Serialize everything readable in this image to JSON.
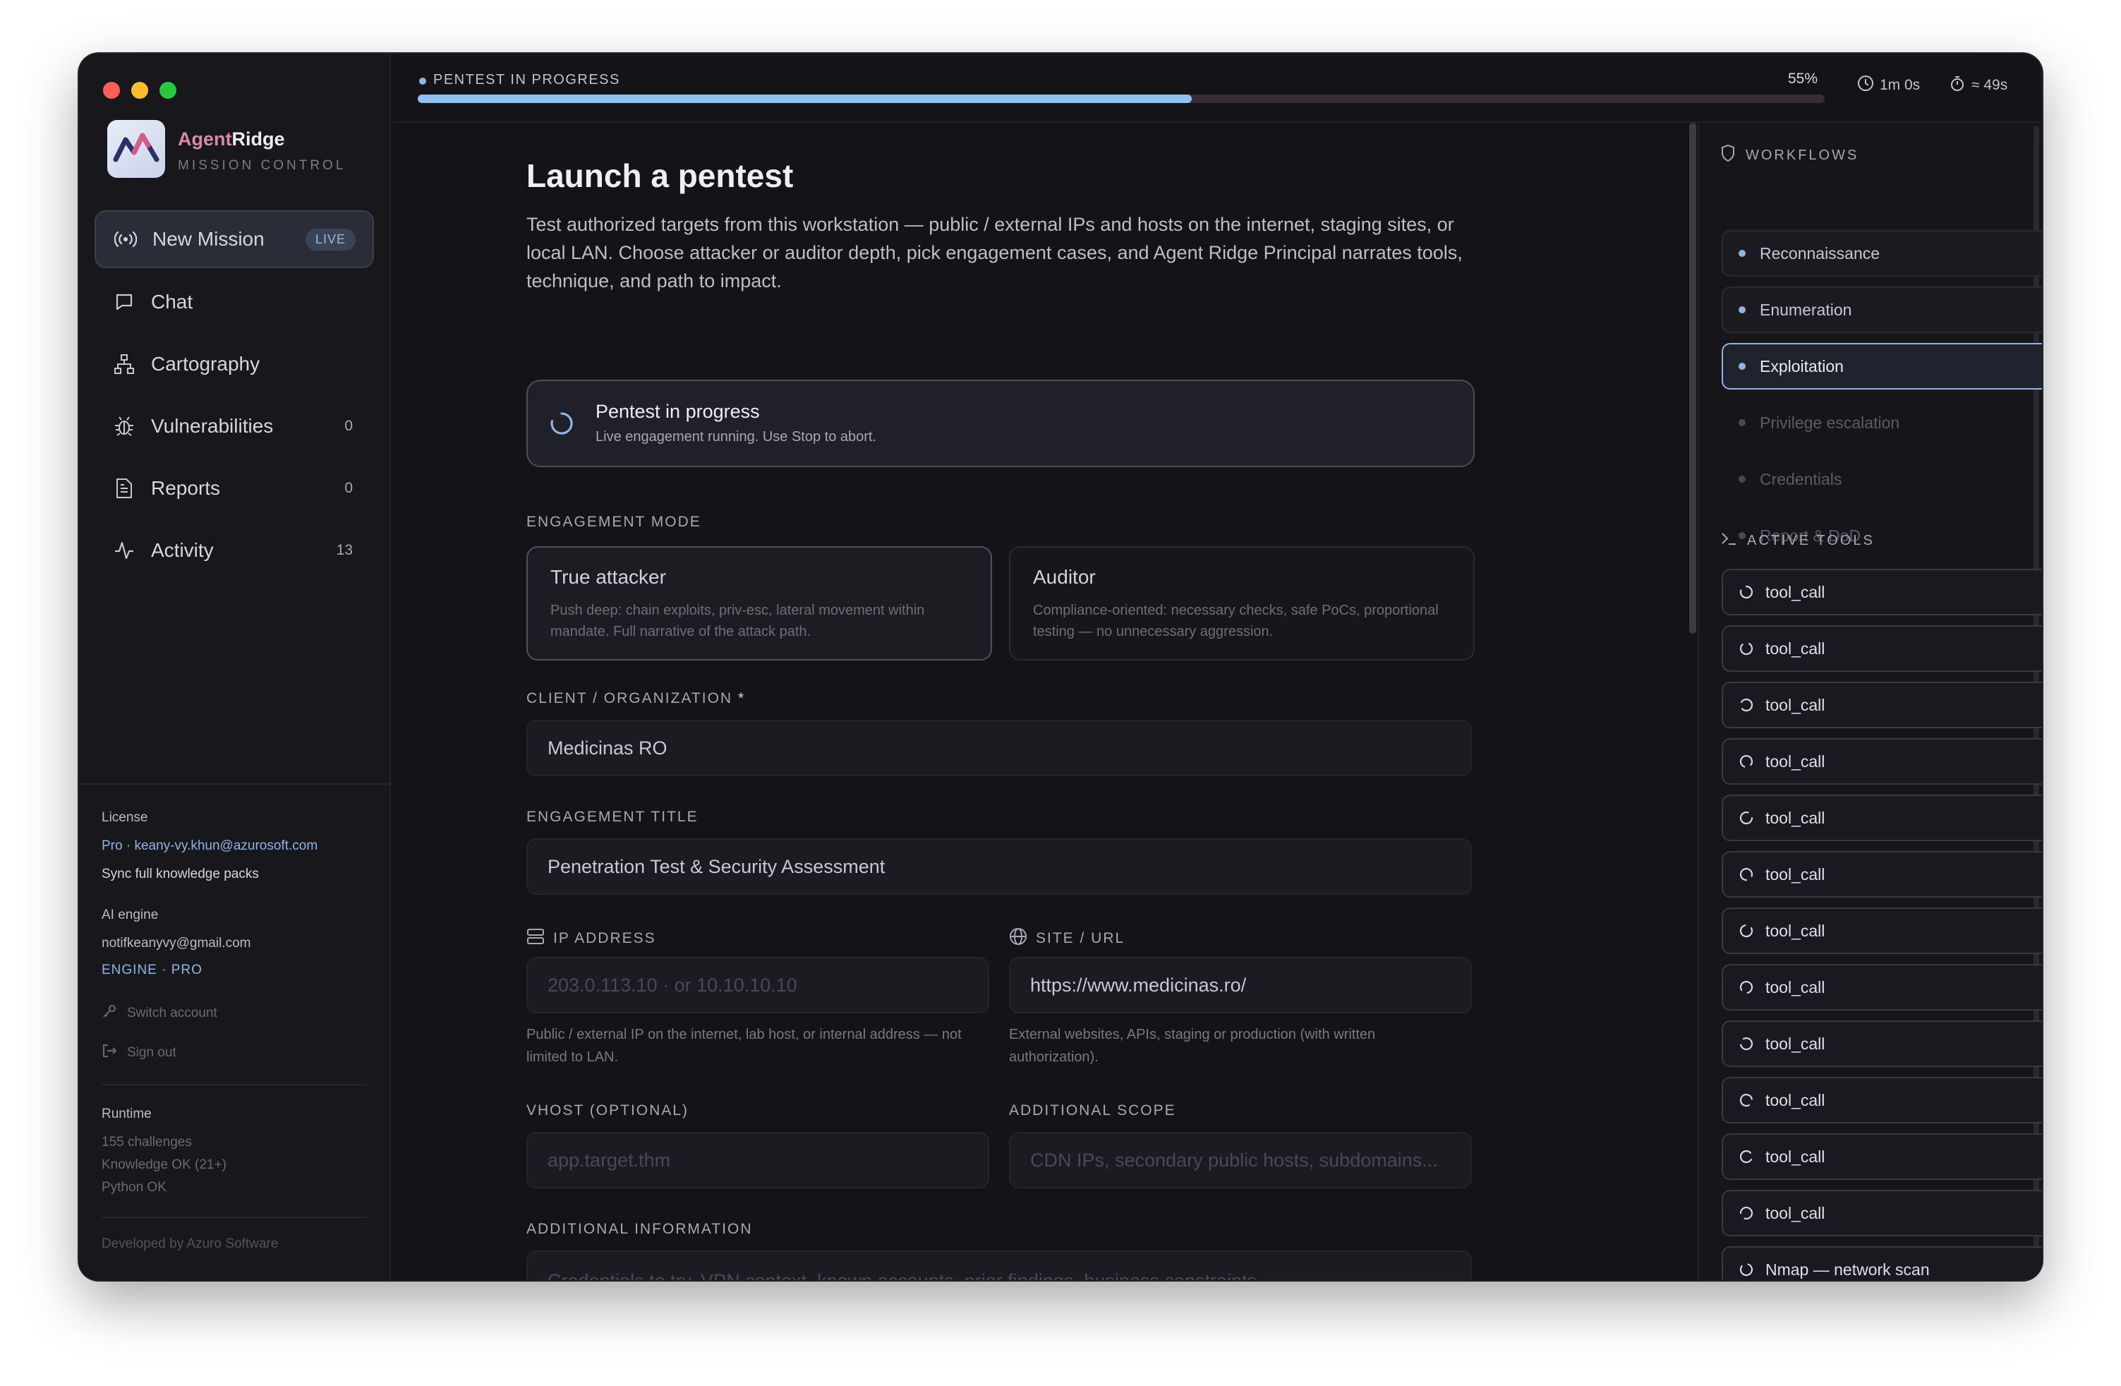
{
  "status": {
    "label": "PENTEST IN PROGRESS",
    "progress_percent": 55,
    "progress_label": "55%",
    "elapsed": "1m 0s",
    "remaining": "≈ 49s"
  },
  "brand": {
    "name_part1": "Agent",
    "name_part2": "Ridge",
    "subtitle": "MISSION CONTROL"
  },
  "nav": {
    "items": [
      {
        "label": "New Mission",
        "badge": "LIVE"
      },
      {
        "label": "Chat"
      },
      {
        "label": "Cartography"
      },
      {
        "label": "Vulnerabilities",
        "count": "0"
      },
      {
        "label": "Reports",
        "count": "0"
      },
      {
        "label": "Activity",
        "count": "13"
      }
    ]
  },
  "sidebar_footer": {
    "license_label": "License",
    "license_value": "Pro · keany-vy.khun@azurosoft.com",
    "sync_link": "Sync full knowledge packs",
    "ai_engine_label": "AI engine",
    "ai_engine_email": "notifkeanyvy@gmail.com",
    "ai_engine_tier": "ENGINE · PRO",
    "switch_account": "Switch account",
    "sign_out": "Sign out",
    "runtime_label": "Runtime",
    "runtime_challenges": "155 challenges",
    "runtime_knowledge": "Knowledge OK (21+)",
    "runtime_python": "Python OK",
    "developer": "Developed by Azuro Software"
  },
  "main": {
    "title": "Launch a pentest",
    "description": "Test authorized targets from this workstation — public / external IPs and hosts on the internet, staging sites, or local LAN. Choose attacker or auditor depth, pick engagement cases, and Agent Ridge Principal narrates tools, technique, and path to impact.",
    "progress_card": {
      "title": "Pentest in progress",
      "subtitle": "Live engagement running. Use Stop to abort."
    },
    "engagement_mode_label": "ENGAGEMENT MODE",
    "modes": [
      {
        "title": "True attacker",
        "description": "Push deep: chain exploits, priv-esc, lateral movement within mandate. Full narrative of the attack path.",
        "selected": true
      },
      {
        "title": "Auditor",
        "description": "Compliance-oriented: necessary checks, safe PoCs, proportional testing — no unnecessary aggression.",
        "selected": false
      }
    ],
    "client_label": "CLIENT / ORGANIZATION",
    "client_required": "*",
    "client_value": "Medicinas RO",
    "title_label": "ENGAGEMENT TITLE",
    "title_value": "Penetration Test & Security Assessment",
    "ip_label": "IP ADDRESS",
    "ip_placeholder": "203.0.113.10 · or 10.10.10.10",
    "ip_hint": "Public / external IP on the internet, lab host, or internal address — not limited to LAN.",
    "url_label": "SITE / URL",
    "url_value": "https://www.medicinas.ro/",
    "url_hint": "External websites, APIs, staging or production (with written authorization).",
    "vhost_label": "VHOST (OPTIONAL)",
    "vhost_placeholder": "app.target.thm",
    "scope_label": "ADDITIONAL SCOPE",
    "scope_placeholder": "CDN IPs, secondary public hosts, subdomains...",
    "info_label": "ADDITIONAL INFORMATION",
    "info_placeholder": "Credentials to try, VPN context, known accounts, prior findings, business constraints..."
  },
  "workflows": {
    "label": "WORKFLOWS",
    "items": [
      {
        "label": "Reconnaissance",
        "state": "done"
      },
      {
        "label": "Enumeration",
        "state": "done"
      },
      {
        "label": "Exploitation",
        "state": "active"
      },
      {
        "label": "Privilege escalation",
        "state": "pending"
      },
      {
        "label": "Credentials",
        "state": "pending"
      },
      {
        "label": "Report & DoD",
        "state": "pending"
      }
    ]
  },
  "active_tools": {
    "label": "ACTIVE TOOLS",
    "items": [
      {
        "label": "tool_call"
      },
      {
        "label": "tool_call"
      },
      {
        "label": "tool_call"
      },
      {
        "label": "tool_call"
      },
      {
        "label": "tool_call"
      },
      {
        "label": "tool_call"
      },
      {
        "label": "tool_call"
      },
      {
        "label": "tool_call"
      },
      {
        "label": "tool_call"
      },
      {
        "label": "tool_call"
      },
      {
        "label": "tool_call"
      },
      {
        "label": "tool_call"
      },
      {
        "label": "Nmap — network scan"
      }
    ]
  },
  "colors": {
    "accent": "#8fb4e3",
    "brand_accent": "#d68aa6",
    "progress_fill": "#8fc0f0",
    "progress_track": "#3a2a36"
  }
}
